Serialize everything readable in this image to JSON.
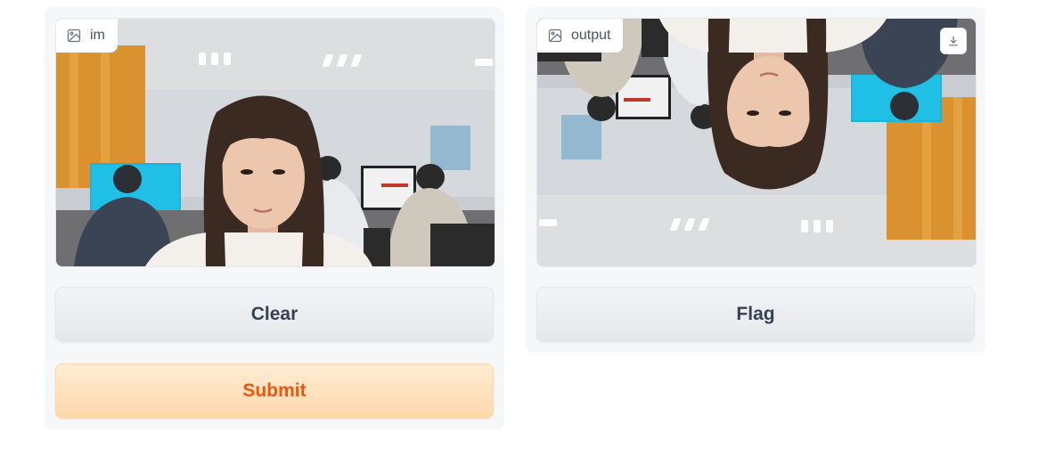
{
  "input_panel": {
    "image_label": "im",
    "image_icon": "image-icon",
    "clear_label": "Clear",
    "submit_label": "Submit"
  },
  "output_panel": {
    "image_label": "output",
    "image_icon": "image-icon",
    "download_icon": "download-icon",
    "flag_label": "Flag"
  },
  "colors": {
    "primary_text": "#ea580c",
    "primary_bg": "#fed7aa",
    "secondary_text": "#374151",
    "panel_bg": "#f6f7f9"
  }
}
